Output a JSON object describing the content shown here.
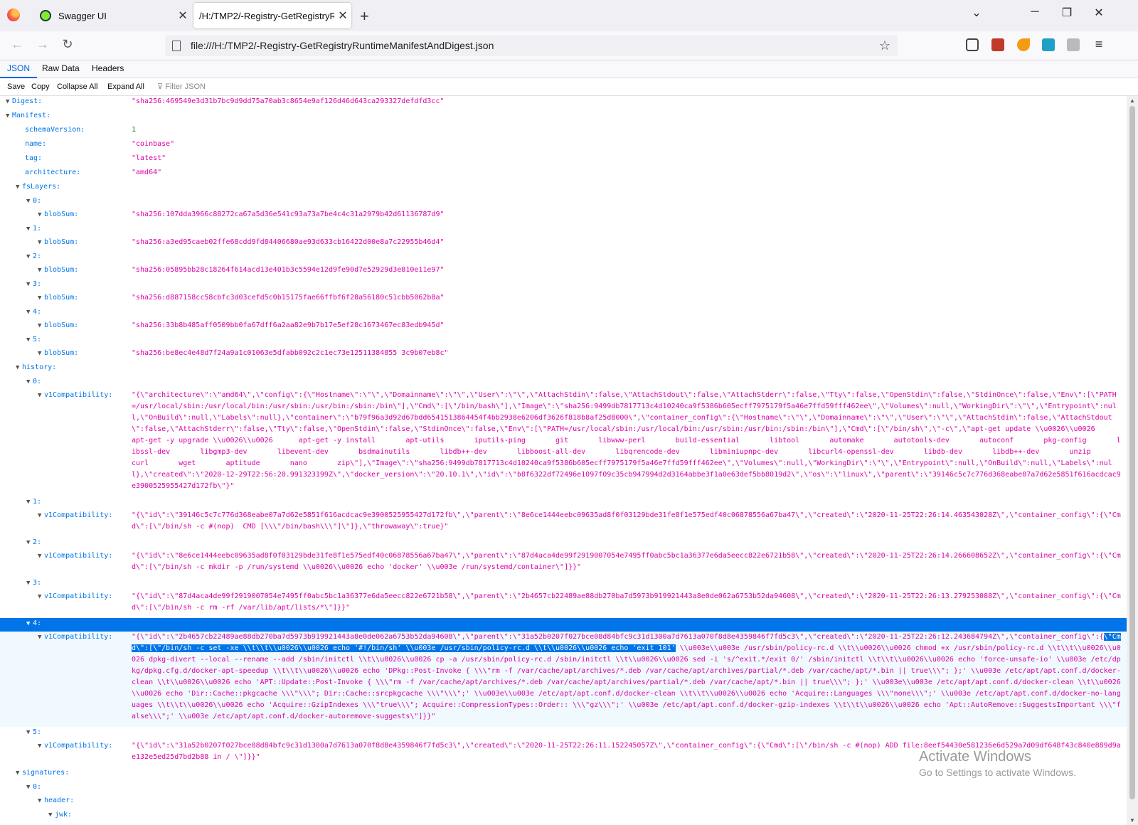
{
  "browser": {
    "tabs": [
      {
        "title": "Swagger UI",
        "icon": "swagger-icon",
        "color": "#85ea2d"
      },
      {
        "title": "/H:/TMP2/-Registry-GetRegistryRuntimeManifestAndDigest.json",
        "icon": "page-icon"
      }
    ],
    "url": "file:///H:/TMP2/-Registry-GetRegistryRuntimeManifestAndDigest.json"
  },
  "viewer": {
    "tabs": [
      "JSON",
      "Raw Data",
      "Headers"
    ],
    "toolbar": [
      "Save",
      "Copy",
      "Collapse All",
      "Expand All"
    ],
    "filter_placeholder": "Filter JSON"
  },
  "json": {
    "digest_key": "Digest:",
    "digest": "\"sha256:469549e3d31b7bc9d9dd75a70ab3c8654e9af126d46d643ca293327defdfd3cc\"",
    "manifest_key": "Manifest:",
    "schemaVersion_key": "schemaVersion:",
    "schemaVersion": "1",
    "name_key": "name:",
    "name": "\"coinbase\"",
    "tag_key": "tag:",
    "tag": "\"latest\"",
    "architecture_key": "architecture:",
    "architecture": "\"amd64\"",
    "fsLayers_key": "fsLayers:",
    "blobSum_key": "blobSum:",
    "fsLayers": [
      {
        "idx": "0:",
        "blobSum": "\"sha256:107dda3966c88272ca67a5d36e541c93a73a7be4c4c31a2979b42d61136787d9\""
      },
      {
        "idx": "1:",
        "blobSum": "\"sha256:a3ed95caeb02ffe68cdd9fd84406680ae93d633cb16422d00e8a7c22955b46d4\""
      },
      {
        "idx": "2:",
        "blobSum": "\"sha256:05895bb28c18264f614acd13e401b3c5594e12d9fe90d7e52929d3e810e11e97\""
      },
      {
        "idx": "3:",
        "blobSum": "\"sha256:d887158cc58cbfc3d03cefd5c0b15175fae66ffbf6f28a56180c51cbb5062b8a\""
      },
      {
        "idx": "4:",
        "blobSum": "\"sha256:33b8b485aff0509bb0fa67dff6a2aa82e9b7b17e5ef28c1673467ec83edb945d\""
      },
      {
        "idx": "5:",
        "blobSum": "\"sha256:be8ec4e48d7f24a9a1c01063e5dfabb092c2c1ec73e12511384855 3c9b07eb8c\""
      }
    ],
    "history_key": "history:",
    "v1_key": "v1Compatibility:",
    "history": [
      {
        "idx": "0:",
        "v1": "\"{\\\"architecture\\\":\\\"amd64\\\",\\\"config\\\":{\\\"Hostname\\\":\\\"\\\",\\\"Domainname\\\":\\\"\\\",\\\"User\\\":\\\"\\\",\\\"AttachStdin\\\":false,\\\"AttachStdout\\\":false,\\\"AttachStderr\\\":false,\\\"Tty\\\":false,\\\"OpenStdin\\\":false,\\\"StdinOnce\\\":false,\\\"Env\\\":[\\\"PATH=/usr/local/sbin:/usr/local/bin:/usr/sbin:/usr/bin:/sbin:/bin\\\"],\\\"Cmd\\\":[\\\"/bin/bash\\\"],\\\"Image\\\":\\\"sha256:9499db7817713c4d10240ca9f5386b605ecff7975179f5a46e7ffd59fff462ee\\\",\\\"Volumes\\\":null,\\\"WorkingDir\\\":\\\"\\\",\\\"Entrypoint\\\":null,\\\"OnBuild\\\":null,\\\"Labels\\\":null},\\\"container\\\":\\\"b79f96a3d92d67bdd6541513864454f4bb2938e6206df3626f818b8af25d8000\\\",\\\"container_config\\\":{\\\"Hostname\\\":\\\"\\\",\\\"Domainname\\\":\\\"\\\",\\\"User\\\":\\\"\\\",\\\"AttachStdin\\\":false,\\\"AttachStdout\\\":false,\\\"AttachStderr\\\":false,\\\"Tty\\\":false,\\\"OpenStdin\\\":false,\\\"StdinOnce\\\":false,\\\"Env\\\":[\\\"PATH=/usr/local/sbin:/usr/local/bin:/usr/sbin:/usr/bin:/sbin:/bin\\\"],\\\"Cmd\\\":[\\\"/bin/sh\\\",\\\"-c\\\",\\\"apt-get update \\\\u0026\\\\u0026      apt-get -y upgrade \\\\u0026\\\\u0026      apt-get -y install       apt-utils       iputils-ping       git       libwww-perl       build-essential       libtool       automake       autotools-dev       autoconf       pkg-config       libssl-dev       libgmp3-dev       libevent-dev       bsdmainutils       libdb++-dev       libboost-all-dev       libqrencode-dev       libminiupnpc-dev       libcurl4-openssl-dev       libdb-dev       libdb++-dev       unzip       curl       wget       aptitude       nano       zip\\\"],\\\"Image\\\":\\\"sha256:9499db7817713c4d10240ca9f5386b605ecff7975179f5a46e7ffd59fff462ee\\\",\\\"Volumes\\\":null,\\\"WorkingDir\\\":\\\"\\\",\\\"Entrypoint\\\":null,\\\"OnBuild\\\":null,\\\"Labels\\\":null},\\\"created\\\":\\\"2020-12-29T22:56:20.991323199Z\\\",\\\"docker_version\\\":\\\"20.10.1\\\",\\\"id\\\":\\\"b8f6322df72496e1097f09c35cb947994d2d3164abbe3f1a0e63def5bb8019d2\\\",\\\"os\\\":\\\"linux\\\",\\\"parent\\\":\\\"39146c5c7c776d368eabe07a7d62e5851f616acdcac9e3900525955427d172fb\\\"}\""
      },
      {
        "idx": "1:",
        "v1": "\"{\\\"id\\\":\\\"39146c5c7c776d368eabe07a7d62e5851f616acdcac9e3900525955427d172fb\\\",\\\"parent\\\":\\\"8e6ce1444eebc09635ad8f0f03129bde31fe8f1e575edf40c06878556a67ba47\\\",\\\"created\\\":\\\"2020-11-25T22:26:14.463543028Z\\\",\\\"container_config\\\":{\\\"Cmd\\\":[\\\"/bin/sh -c #(nop)  CMD [\\\\\\\"/bin/bash\\\\\\\"]\\\"]},\\\"throwaway\\\":true}\""
      },
      {
        "idx": "2:",
        "v1": "\"{\\\"id\\\":\\\"8e6ce1444eebc09635ad8f0f03129bde31fe8f1e575edf40c06878556a67ba47\\\",\\\"parent\\\":\\\"87d4aca4de99f2919007054e7495ff0abc5bc1a36377e6da5eecc822e6721b58\\\",\\\"created\\\":\\\"2020-11-25T22:26:14.266608652Z\\\",\\\"container_config\\\":{\\\"Cmd\\\":[\\\"/bin/sh -c mkdir -p /run/systemd \\\\u0026\\\\u0026 echo 'docker' \\\\u003e /run/systemd/container\\\"]}}\""
      },
      {
        "idx": "3:",
        "v1": "\"{\\\"id\\\":\\\"87d4aca4de99f2919007054e7495ff0abc5bc1a36377e6da5eecc822e6721b58\\\",\\\"parent\\\":\\\"2b4657cb22489ae88db270ba7d5973b919921443a8e0de062a6753b52da94608\\\",\\\"created\\\":\\\"2020-11-25T22:26:13.279253088Z\\\",\\\"container_config\\\":{\\\"Cmd\\\":[\\\"/bin/sh -c rm -rf /var/lib/apt/lists/*\\\"]}}\""
      },
      {
        "idx": "4:",
        "v1_pre": "\"{\\\"id\\\":\\\"2b4657cb22489ae88db270ba7d5973b919921443a8e0de062a6753b52da94608\\\",\\\"parent\\\":\\\"31a52b0207f027bce08d84bfc9c31d1300a7d7613a070f8d8e4359846f7fd5c3\\\",\\\"created\\\":\\\"2020-11-25T22:26:12.243684794Z\\\",\\\"container_config\\\":{",
        "v1_sel": "\\\"Cmd\\\":[\\\"/bin/sh -c set -xe \\\\t\\\\t\\\\u0026\\\\u0026 echo '#!/bin/sh' \\\\u003e /usr/sbin/policy-rc.d \\\\t\\\\u0026\\\\u0026 echo 'exit 101'",
        "v1_post": " \\\\u003e\\\\u003e /usr/sbin/policy-rc.d \\\\t\\\\u0026\\\\u0026 chmod +x /usr/sbin/policy-rc.d \\\\t\\\\t\\\\u0026\\\\u0026 dpkg-divert --local --rename --add /sbin/initctl \\\\t\\\\u0026\\\\u0026 cp -a /usr/sbin/policy-rc.d /sbin/initctl \\\\t\\\\u0026\\\\u0026 sed -i 's/^exit.*/exit 0/' /sbin/initctl \\\\t\\\\t\\\\u0026\\\\u0026 echo 'force-unsafe-io' \\\\u003e /etc/dpkg/dpkg.cfg.d/docker-apt-speedup \\\\t\\\\t\\\\u0026\\\\u0026 echo 'DPkg::Post-Invoke { \\\\\\\"rm -f /var/cache/apt/archives/*.deb /var/cache/apt/archives/partial/*.deb /var/cache/apt/*.bin || true\\\\\\\"; };' \\\\u003e /etc/apt/apt.conf.d/docker-clean \\\\t\\\\u0026\\\\u0026 echo 'APT::Update::Post-Invoke { \\\\\\\"rm -f /var/cache/apt/archives/*.deb /var/cache/apt/archives/partial/*.deb /var/cache/apt/*.bin || true\\\\\\\"; };' \\\\u003e\\\\u003e /etc/apt/apt.conf.d/docker-clean \\\\t\\\\u0026\\\\u0026 echo 'Dir::Cache::pkgcache \\\\\\\"\\\\\\\"; Dir::Cache::srcpkgcache \\\\\\\"\\\\\\\";' \\\\u003e\\\\u003e /etc/apt/apt.conf.d/docker-clean \\\\t\\\\t\\\\u0026\\\\u0026 echo 'Acquire::Languages \\\\\\\"none\\\\\\\";' \\\\u003e /etc/apt/apt.conf.d/docker-no-languages \\\\t\\\\t\\\\u0026\\\\u0026 echo 'Acquire::GzipIndexes \\\\\\\"true\\\\\\\"; Acquire::CompressionTypes::Order:: \\\\\\\"gz\\\\\\\";' \\\\u003e /etc/apt/apt.conf.d/docker-gzip-indexes \\\\t\\\\t\\\\u0026\\\\u0026 echo 'Apt::AutoRemove::SuggestsImportant \\\\\\\"false\\\\\\\";' \\\\u003e /etc/apt/apt.conf.d/docker-autoremove-suggests\\\"]}}\""
      },
      {
        "idx": "5:",
        "v1": "\"{\\\"id\\\":\\\"31a52b0207f027bce08d84bfc9c31d1300a7d7613a070f8d8e4359846f7fd5c3\\\",\\\"created\\\":\\\"2020-11-25T22:26:11.152245057Z\\\",\\\"container_config\\\":{\\\"Cmd\\\":[\\\"/bin/sh -c #(nop) ADD file:8eef54430e581236e6d529a7d09df648f43c840e889d9ae132e5ed25d7bd2b88 in / \\\"]}}\""
      }
    ],
    "signatures_key": "signatures:",
    "sig0_idx": "0:",
    "header_key": "header:",
    "jwk_key": "jwk:"
  },
  "watermark": {
    "title": "Activate Windows",
    "subtitle": "Go to Settings to activate Windows."
  }
}
